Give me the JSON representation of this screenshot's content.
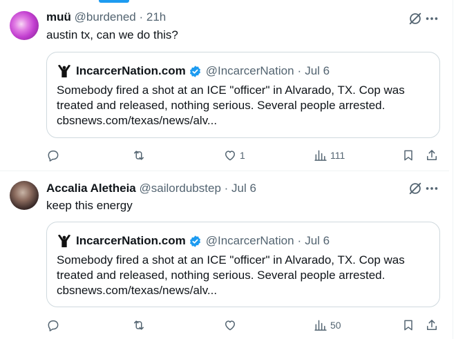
{
  "tweets": [
    {
      "author": {
        "name": "muü",
        "handle": "@burdened",
        "time": "21h"
      },
      "text": "austin tx, can we do this?",
      "quote": {
        "name": "IncarcerNation.com",
        "handle": "@IncarcerNation",
        "time": "Jul 6",
        "text": "Somebody fired a shot at an ICE \"officer\" in Alvarado, TX. Cop was treated and released, nothing serious. Several people arrested. cbsnews.com/texas/news/alv..."
      },
      "stats": {
        "replies": "",
        "reposts": "",
        "likes": "1",
        "views": "111"
      }
    },
    {
      "author": {
        "name": "Accalia Aletheia",
        "handle": "@sailordubstep",
        "time": "Jul 6"
      },
      "text": "keep this energy",
      "quote": {
        "name": "IncarcerNation.com",
        "handle": "@IncarcerNation",
        "time": "Jul 6",
        "text": "Somebody fired a shot at an ICE \"officer\" in Alvarado, TX. Cop was treated and released, nothing serious. Several people arrested. cbsnews.com/texas/news/alv..."
      },
      "stats": {
        "replies": "",
        "reposts": "",
        "likes": "",
        "views": "50"
      }
    }
  ],
  "dot": "·",
  "colors": {
    "accent": "#1d9bf0",
    "secondary_text": "#536471",
    "border": "#cfd9de"
  }
}
